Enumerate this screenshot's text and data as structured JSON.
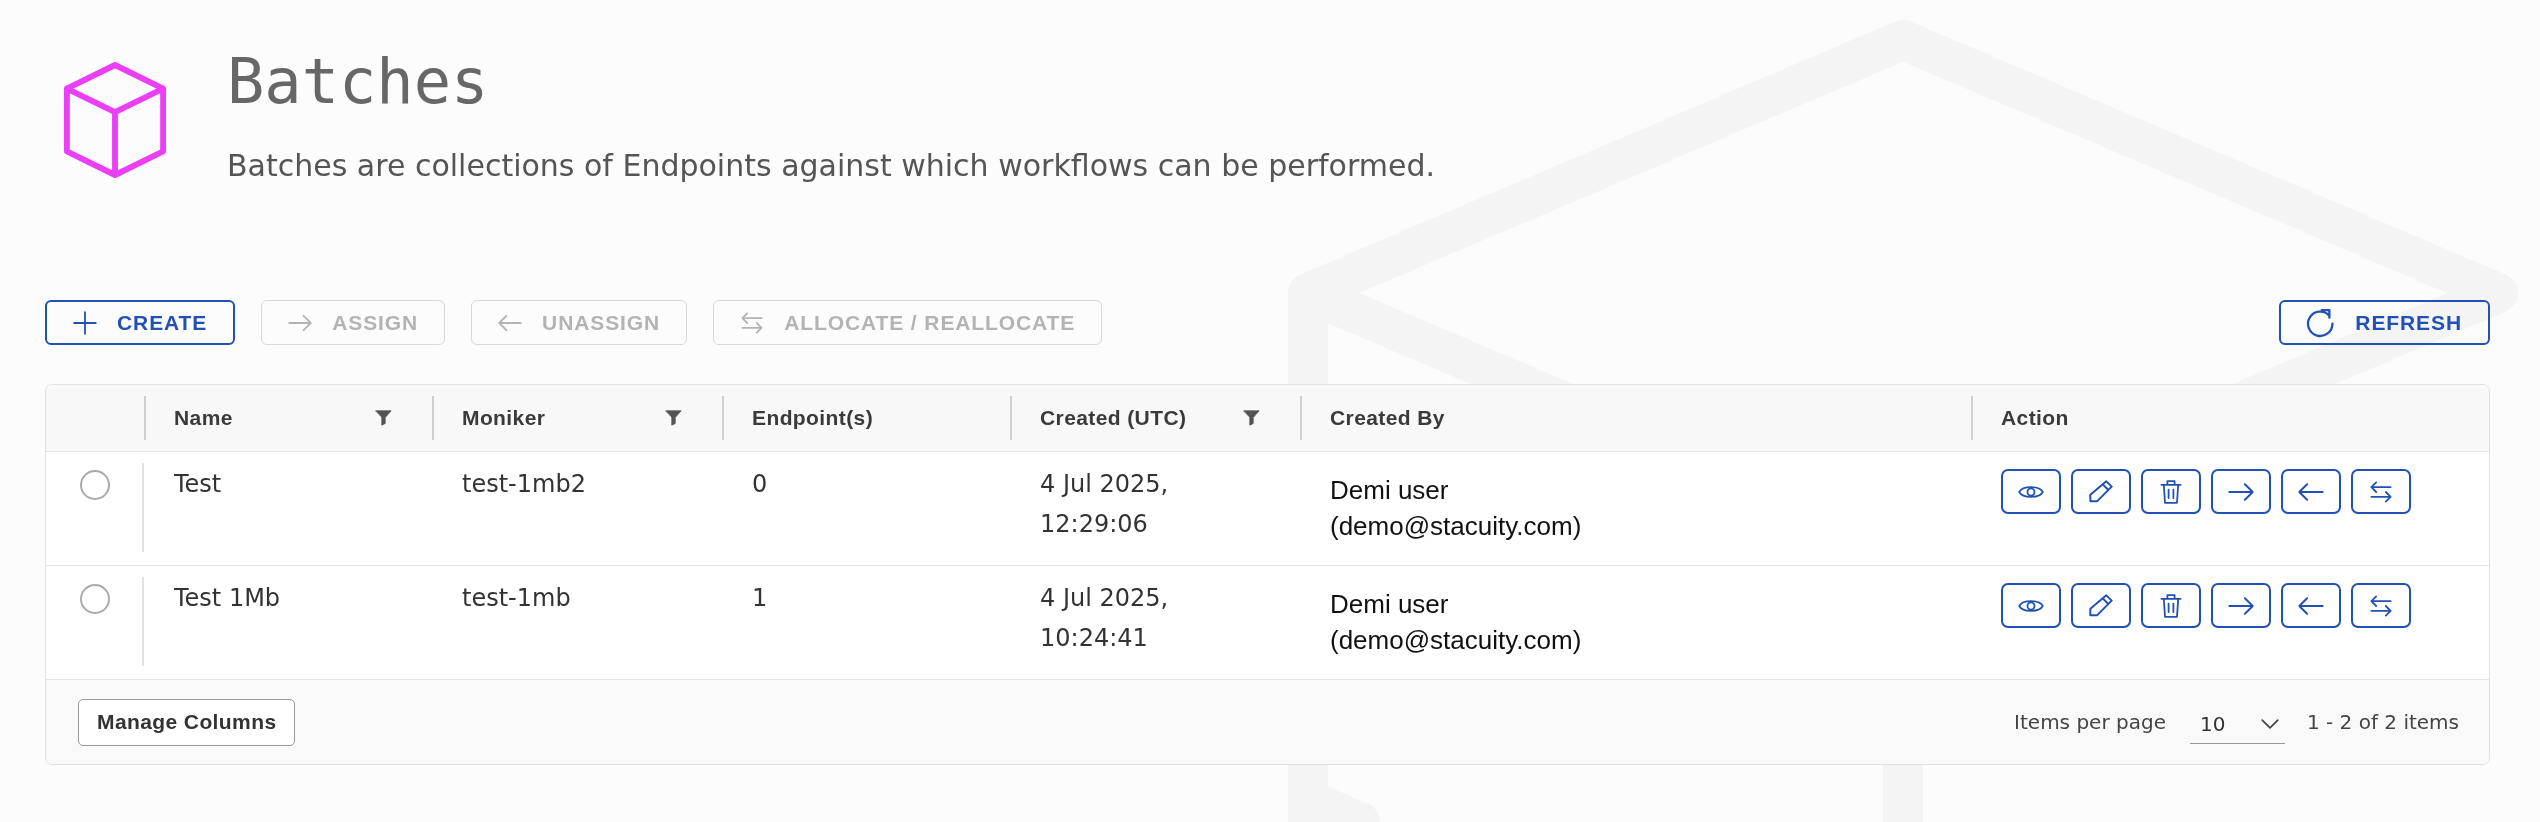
{
  "header": {
    "title": "Batches",
    "description": "Batches are collections of Endpoints against which workflows can be performed."
  },
  "toolbar": {
    "actions": [
      {
        "kind": "create",
        "label": "CREATE",
        "disabled": false
      },
      {
        "kind": "assign",
        "label": "ASSIGN",
        "disabled": true
      },
      {
        "kind": "unassign",
        "label": "UNASSIGN",
        "disabled": true
      },
      {
        "kind": "allocate",
        "label": "ALLOCATE / REALLOCATE",
        "disabled": true
      }
    ],
    "refresh": {
      "label": "REFRESH",
      "disabled": false
    }
  },
  "table": {
    "columns": [
      {
        "kind": "text",
        "label": "Name",
        "filterable": true
      },
      {
        "kind": "text",
        "label": "Moniker",
        "filterable": true
      },
      {
        "kind": "text",
        "label": "Endpoint(s)",
        "filterable": false
      },
      {
        "kind": "datetime",
        "label": "Created (UTC)",
        "filterable": true
      },
      {
        "kind": "user",
        "label": "Created By",
        "filterable": false
      },
      {
        "kind": "actions",
        "label": "Action",
        "filterable": false
      }
    ],
    "rows": [
      {
        "selected": false,
        "cells": [
          "Test",
          "test-1mb2",
          "0",
          "4 Jul 2025, 12:29:06",
          "Demi user (demo@stacuity.com)"
        ]
      },
      {
        "selected": false,
        "cells": [
          "Test 1Mb",
          "test-1mb",
          "1",
          "4 Jul 2025, 10:24:41",
          "Demi user (demo@stacuity.com)"
        ]
      }
    ]
  },
  "footer": {
    "manage_columns": "Manage Columns",
    "items_per_page_label": "Items per page",
    "page_size": "10",
    "range": "1 - 2 of 2 items"
  }
}
